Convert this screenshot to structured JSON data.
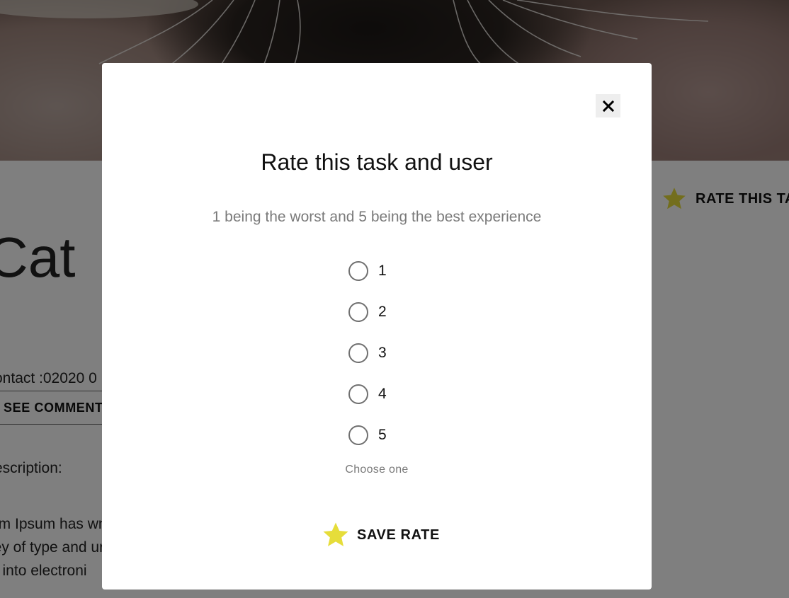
{
  "colors": {
    "star_yellow": "#e6dd3a",
    "overlay": "rgba(0,0,0,0.5)",
    "muted_text": "#7a7a7a"
  },
  "background_page": {
    "title_fragment": "Cat",
    "rate_button_label": "RATE THIS TA",
    "rate_button_icon": "star-icon",
    "contact_text": "ontact :02020 0",
    "see_comments_label": "SEE COMMENT",
    "description_label": "escription:",
    "description_lines": [
      "em Ipsum has                                                                                    wn printer took a",
      "ley of type and                                                                                  uries, but also the",
      "p into electroni"
    ]
  },
  "modal": {
    "close_icon": "close-icon",
    "title": "Rate this task and user",
    "subtitle": "1 being the worst and 5 being the best experience",
    "options": [
      {
        "label": "1",
        "selected": false
      },
      {
        "label": "2",
        "selected": false
      },
      {
        "label": "3",
        "selected": false
      },
      {
        "label": "4",
        "selected": false
      },
      {
        "label": "5",
        "selected": false
      }
    ],
    "helper_text": "Choose one",
    "save_label": "SAVE RATE",
    "save_icon": "star-icon"
  }
}
